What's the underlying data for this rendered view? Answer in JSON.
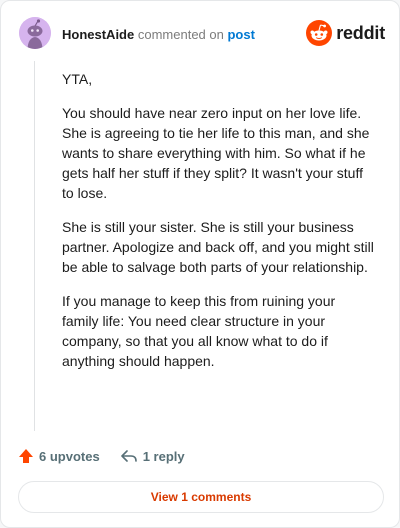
{
  "header": {
    "username": "HonestAide",
    "action_text": "commented on",
    "post_link": "post",
    "brand": "reddit"
  },
  "comment": {
    "paragraphs": [
      "YTA,",
      "You should have near zero input on her love life. She is agreeing to tie her life to this man, and she wants to share everything with him. So what if he gets half her stuff if they split? It wasn't your stuff to lose.",
      "She is still your sister. She is still your business partner. Apologize and back off, and you might still be able to salvage both parts of your relationship.",
      "If you manage to keep this from ruining your family life: You need clear structure in your company, so that you all know what to do if anything should happen."
    ]
  },
  "actions": {
    "upvotes": "6 upvotes",
    "replies": "1 reply"
  },
  "footer": {
    "view_comments": "View 1 comments"
  },
  "colors": {
    "upvote": "#ff4500",
    "link": "#0079d3",
    "view_button_text": "#d93a00",
    "avatar_bg": "#d6b4ee"
  },
  "icons": {
    "avatar": "snoo-avatar-icon",
    "brand": "reddit-logo-icon",
    "upvote": "upvote-arrow-icon",
    "reply": "reply-arrow-icon"
  }
}
